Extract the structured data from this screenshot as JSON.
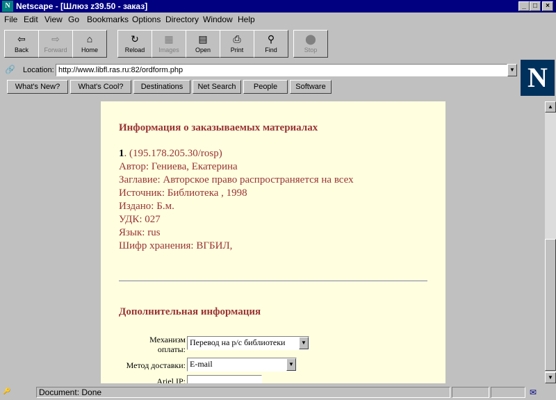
{
  "window": {
    "title": "Netscape - [Шлюз z39.50 - заказ]",
    "app_icon": "N",
    "minimize": "_",
    "maximize": "□",
    "close": "×"
  },
  "menu": [
    "File",
    "Edit",
    "View",
    "Go",
    "Bookmarks",
    "Options",
    "Directory",
    "Window",
    "Help"
  ],
  "toolbar": {
    "back": "Back",
    "forward": "Forward",
    "home": "Home",
    "reload": "Reload",
    "images": "Images",
    "open": "Open",
    "print": "Print",
    "find": "Find",
    "stop": "Stop"
  },
  "location": {
    "label": "Location:",
    "url": "http://www.libfl.ras.ru:82/ordform.php"
  },
  "directory_buttons": [
    "What's New?",
    "What's Cool?",
    "Destinations",
    "Net Search",
    "People",
    "Software"
  ],
  "page": {
    "section1_title": "Информация о заказываемых материалах",
    "item_number": "1",
    "item_source": ". (195.178.205.30/rosp)",
    "author": "Автор: Гениева, Екатерина",
    "title": "Заглавие: Авторское право распространяется на всех",
    "source": "Источник: Библиотека , 1998",
    "published": "Издано: Б.м.",
    "udk": "УДК: 027",
    "language": "Язык: rus",
    "shelfmark": "Шифр хранения: ВГБИЛ,",
    "section2_title": "Дополнительная информация",
    "payment_label": "Механизм оплаты:",
    "payment_value": "Перевод на р/с библиотеки",
    "delivery_label": "Метод доставки:",
    "delivery_value": "E-mail",
    "ariel_label": "Ariel IP:"
  },
  "status": {
    "text": "Document: Done"
  }
}
